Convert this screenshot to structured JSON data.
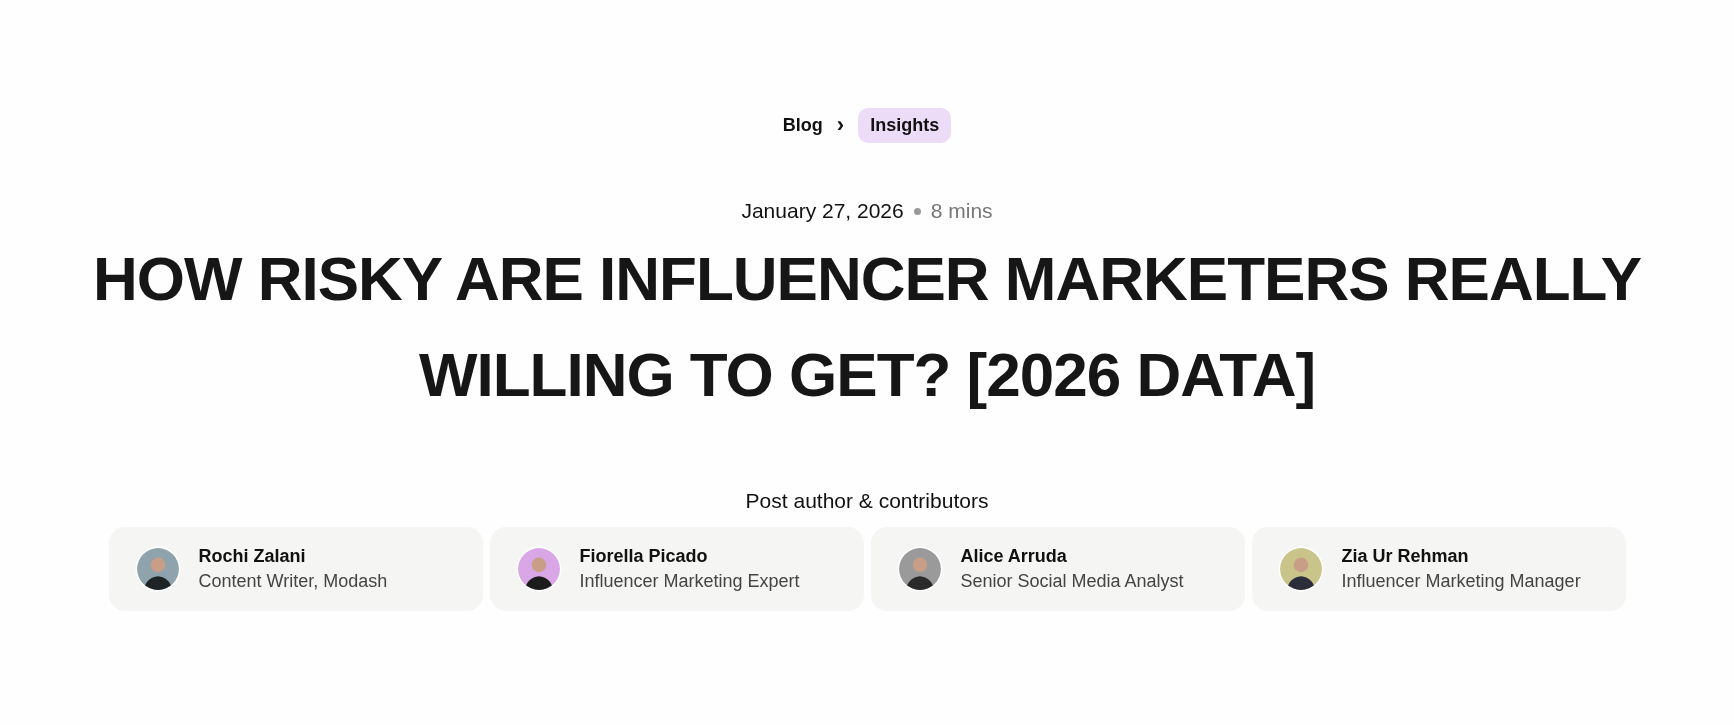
{
  "breadcrumb": [
    {
      "label": "Blog",
      "selected": false
    },
    {
      "label": "Insights",
      "selected": true
    }
  ],
  "breadcrumb_separator": "›",
  "meta": {
    "date": "January 27, 2026",
    "read_time": "8 mins"
  },
  "title": "HOW RISKY ARE INFLUENCER MARKETERS REALLY WILLING TO GET? [2026 DATA]",
  "authors_heading": "Post author & contributors",
  "authors": [
    {
      "name": "Rochi Zalani",
      "role": "Content Writer, Modash"
    },
    {
      "name": "Fiorella Picado",
      "role": "Influencer Marketing Expert"
    },
    {
      "name": "Alice Arruda",
      "role": "Senior Social Media Analyst"
    },
    {
      "name": "Zia Ur Rehman",
      "role": "Influencer Marketing Manager"
    }
  ]
}
